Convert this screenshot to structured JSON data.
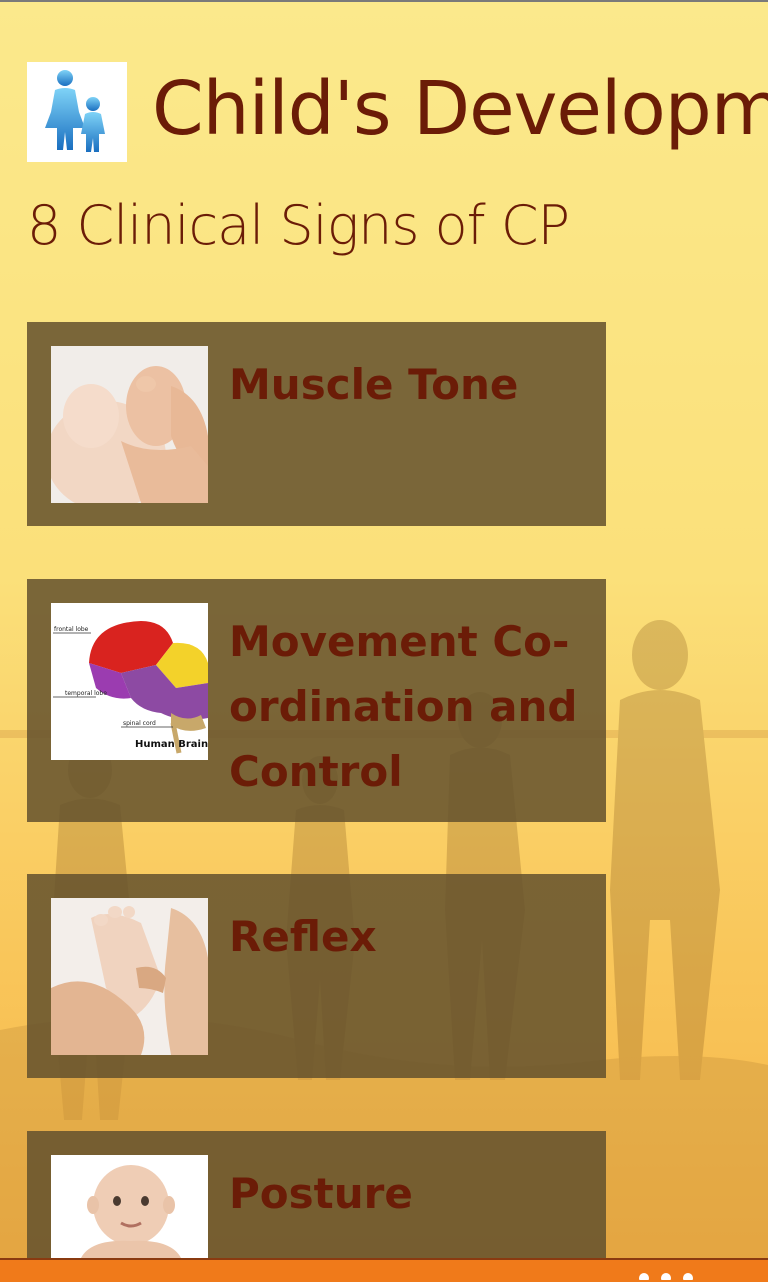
{
  "app": {
    "title": "Child's Development",
    "logo_icon": "parent-child-icon"
  },
  "page": {
    "title": "8 Clinical Signs of CP"
  },
  "items": [
    {
      "label": "Muscle Tone",
      "thumb_icon": "baby-foot-photo"
    },
    {
      "label": "Movement Co-ordination and Control",
      "thumb_icon": "brain-diagram"
    },
    {
      "label": "Reflex",
      "thumb_icon": "foot-reflex-photo"
    },
    {
      "label": "Posture",
      "thumb_icon": "baby-photo"
    }
  ],
  "brain_labels": {
    "frontal": "frontal lobe",
    "temporal": "temporal lobe",
    "spinal": "spinal cord",
    "caption": "Human Brain"
  },
  "colors": {
    "accent_text": "#6b1c07",
    "tile_bg": "#64522d",
    "app_bar": "#f07a1a"
  },
  "app_bar": {
    "more_icon": "ellipsis-icon"
  }
}
